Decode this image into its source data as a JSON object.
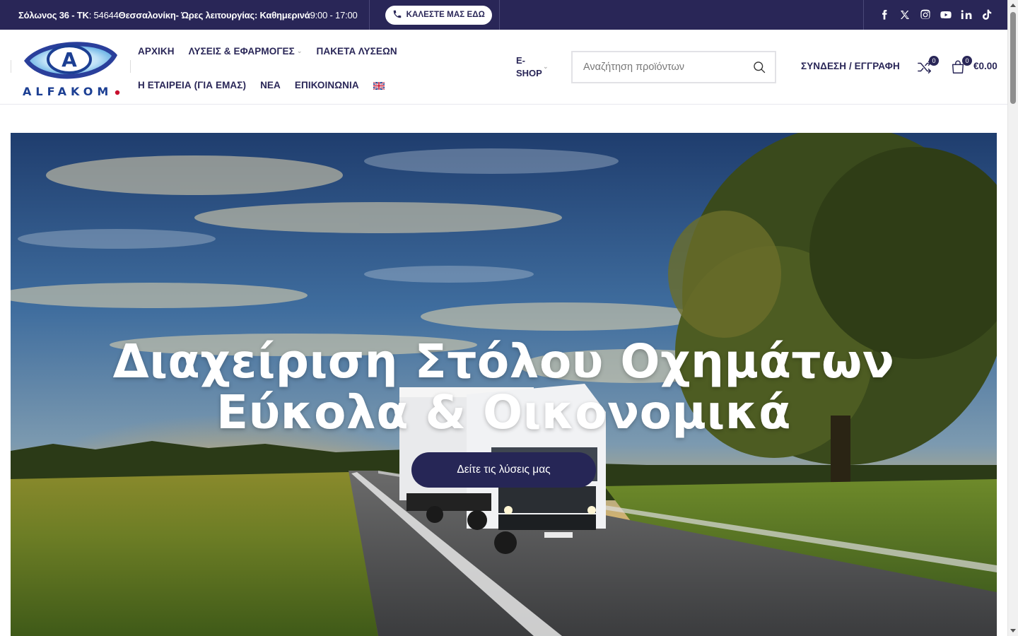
{
  "topbar": {
    "address_bold_1": "Σόλωνος 36 - ΤΚ",
    "address_light_1": " : 54644 ",
    "address_bold_2": "Θεσσαλονίκη- Ώρες λειτουργίας: Καθημερινά",
    "address_light_2": " 9:00 - 17:00",
    "call_button": "ΚΑΛΕΣΤΕ ΜΑΣ ΕΔΩ",
    "socials": [
      "facebook-icon",
      "x-icon",
      "instagram-icon",
      "youtube-icon",
      "linkedin-icon",
      "tiktok-icon"
    ]
  },
  "logo": {
    "text": "ALFAKOM",
    "letter": "A",
    "colors": {
      "blue": "#1e3a8a",
      "light_blue": "#4fa3e0",
      "red": "#c8102e"
    }
  },
  "nav": {
    "row1": [
      {
        "label": "ΑΡΧΙΚΗ",
        "dropdown": false
      },
      {
        "label": "ΛΥΣΕΙΣ & ΕΦΑΡΜΟΓΕΣ",
        "dropdown": true
      },
      {
        "label": "ΠΑΚΕΤΑ ΛΥΣΕΩΝ",
        "dropdown": false
      }
    ],
    "row2": [
      {
        "label": "Η ΕΤΑΙΡΕΙΑ (ΓΙΑ ΕΜΑΣ)",
        "dropdown": false
      },
      {
        "label": "ΝΕΑ",
        "dropdown": false
      },
      {
        "label": "ΕΠΙΚΟΙΝΩΝΙΑ",
        "dropdown": false
      }
    ],
    "language_flag": "uk-flag-icon",
    "eshop_line1": "E-",
    "eshop_line2": "SHOP"
  },
  "search": {
    "placeholder": "Αναζήτηση προϊόντων",
    "icon": "search-icon"
  },
  "account": {
    "login_label": "ΣΥΝΔΕΣΗ / ΕΓΓΡΑΦΗ"
  },
  "compare": {
    "count": "0"
  },
  "cart": {
    "count": "0",
    "total": "€0.00"
  },
  "hero": {
    "title_line1": "Διαχείριση Στόλου Οχημάτων",
    "title_line2": "Εύκολα & Οικονομικά",
    "button_label": "Δείτε τις λύσεις μας"
  },
  "colors": {
    "brand": "#292657",
    "white": "#ffffff"
  }
}
